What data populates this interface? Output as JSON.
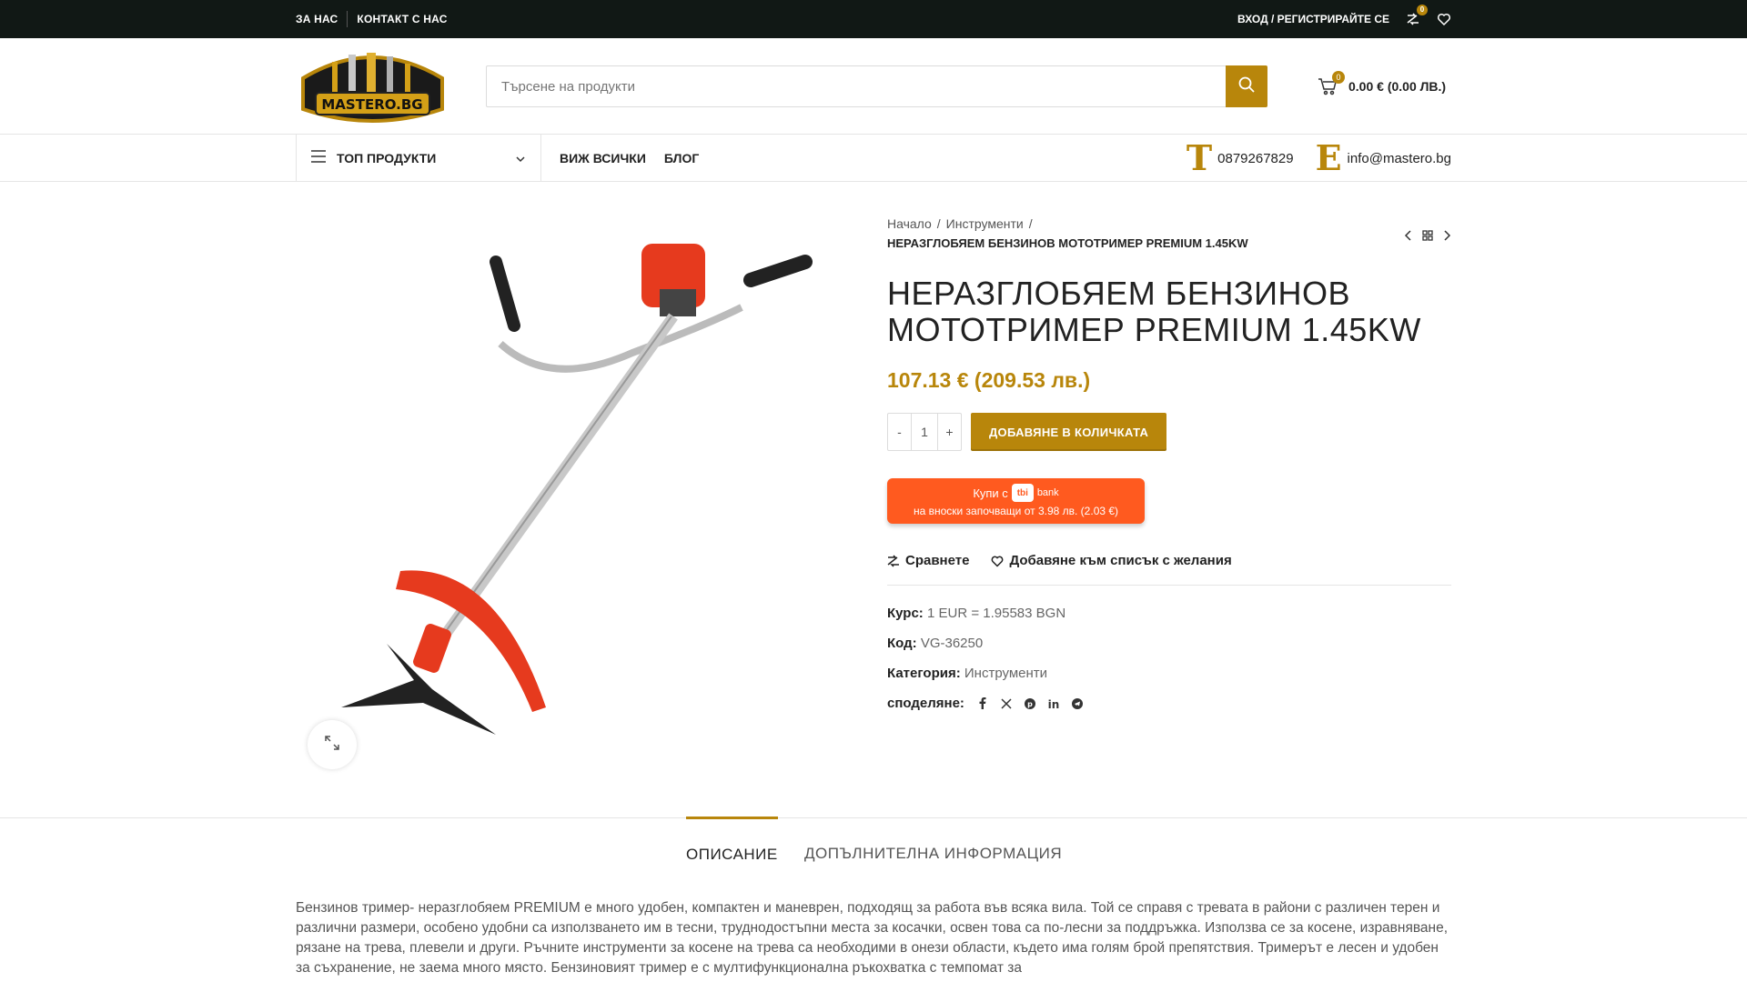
{
  "topbar": {
    "links": [
      "ЗА НАС",
      "КОНТАКТ С НАС"
    ],
    "login": "ВХОД / РЕГИСТРИРАЙТЕ СЕ",
    "compare_count": "0"
  },
  "header": {
    "logo_text": "MASTERO.BG",
    "search_placeholder": "Търсене на продукти",
    "cart_count": "0",
    "cart_total": "0.00 € (0.00 ЛВ.)"
  },
  "nav": {
    "category_label": "ТОП ПРОДУКТИ",
    "links": [
      "ВИЖ ВСИЧКИ",
      "БЛОГ"
    ],
    "phone_letter": "T",
    "phone": "0879267829",
    "email_letter": "E",
    "email": "info@mastero.bg"
  },
  "breadcrumb": {
    "items": [
      "Начало",
      "Инструменти"
    ],
    "current": "НЕРАЗГЛОБЯЕМ БЕНЗИНОВ МОТОТРИМЕР PREMIUM 1.45KW"
  },
  "product": {
    "title": "НЕРАЗГЛОБЯЕМ БЕНЗИНОВ МОТОТРИМЕР PREMIUM 1.45KW",
    "price": "107.13 € (209.53 лв.)",
    "qty_minus": "-",
    "qty": "1",
    "qty_plus": "+",
    "add_to_cart": "ДОБАВЯНЕ В КОЛИЧКАТА",
    "tbi": {
      "line1_pre": "Купи с",
      "logo": "tbi",
      "bank": "bank",
      "line2": "на вноски започващи от 3.98 лв. (2.03 €)"
    },
    "compare": "Сравнете",
    "wishlist": "Добавяне към списък с желания",
    "meta": {
      "rate_label": "Курс:",
      "rate_value": "1 EUR = 1.95583 BGN",
      "sku_label": "Код:",
      "sku_value": "VG-36250",
      "category_label": "Категория:",
      "category_value": "Инструменти",
      "share_label": "споделяне:"
    }
  },
  "tabs": {
    "description": "ОПИСАНИЕ",
    "additional": "ДОПЪЛНИТЕЛНА ИНФОРМАЦИЯ"
  },
  "description": "Бензинов тример- неразглобяем PREMIUM е много удобен, компактен и маневрен, подходящ за работа във всяка вила. Той се справя с тревата в райони с различен терен и различни размери, особено удобни са използването им в тесни, труднодостъпни места за косачки, освен това са по-лесни за поддръжка. Използва се за косене, изравняване, рязане на трева, плевели и други. Ръчните инструменти за косене на трева са необходими в онези области, където има голям брой препятствия. Тримерът е лесен и удобен за съхранение, не заема много място. Бензиновият тример е с мултифункционална ръкохватка с темпомат за",
  "colors": {
    "accent": "#b8860b",
    "topbar": "#111815",
    "tbi": "#ff5a1f"
  }
}
